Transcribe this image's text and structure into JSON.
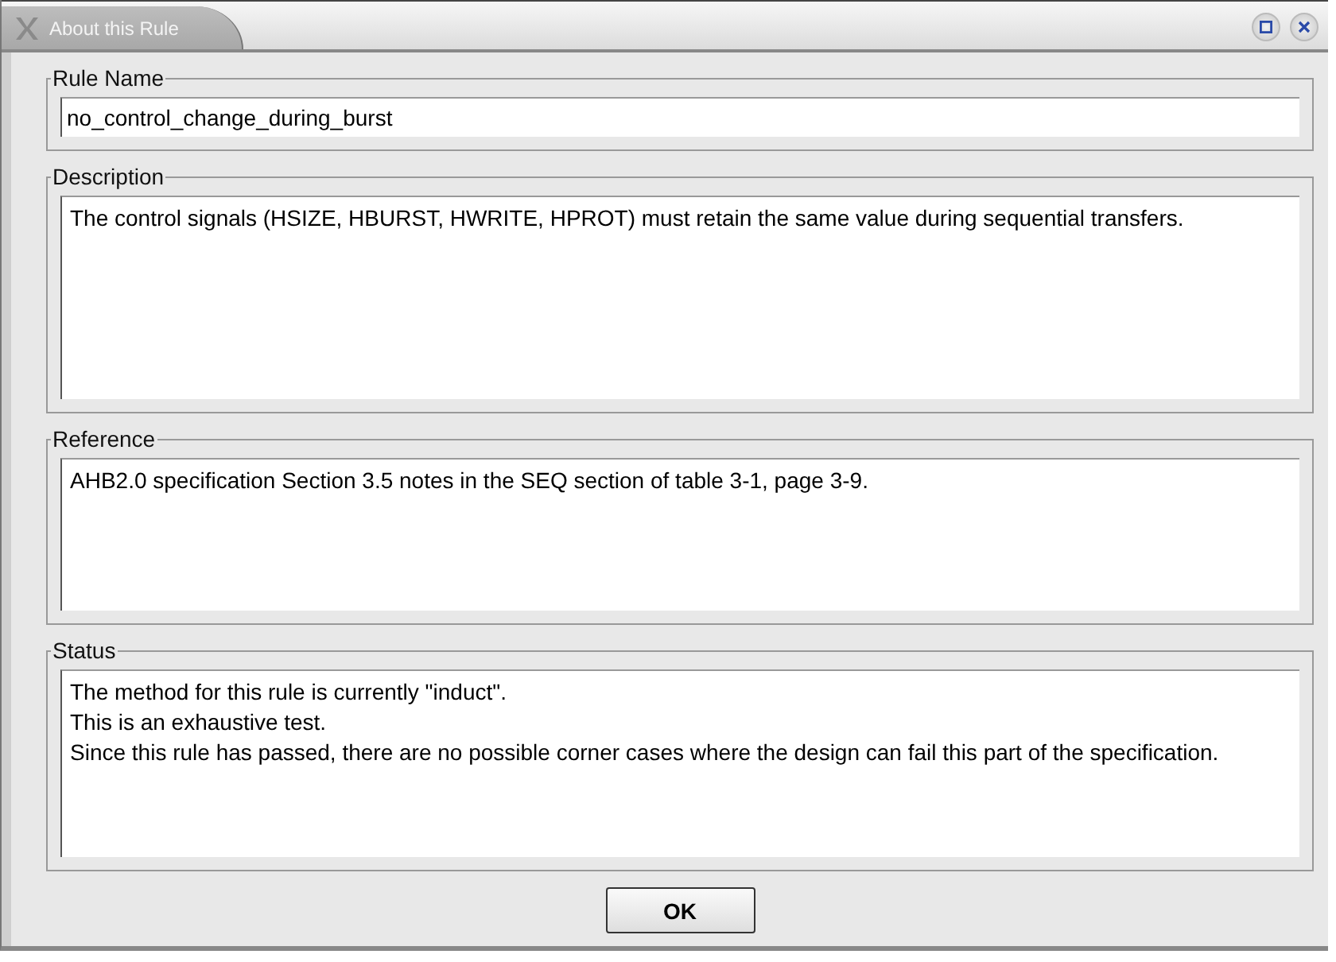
{
  "window": {
    "title": "About this Rule"
  },
  "sections": [
    {
      "kind": "field",
      "label": "Rule Name",
      "value": "no_control_change_during_burst"
    },
    {
      "kind": "area",
      "label": "Description",
      "lines": [
        "The control signals (HSIZE, HBURST, HWRITE, HPROT) must retain the same value during sequential transfers."
      ]
    },
    {
      "kind": "area",
      "label": "Reference",
      "lines": [
        "AHB2.0 specification Section 3.5 notes in the SEQ section of table 3-1, page 3-9."
      ]
    },
    {
      "kind": "area",
      "label": "Status",
      "lines": [
        "The method for this rule is currently \"induct\".",
        "This is an exhaustive test.",
        "Since this rule has passed, there are no possible corner cases where the design can fail this part of the specification."
      ]
    }
  ],
  "buttons": [
    "OK"
  ]
}
